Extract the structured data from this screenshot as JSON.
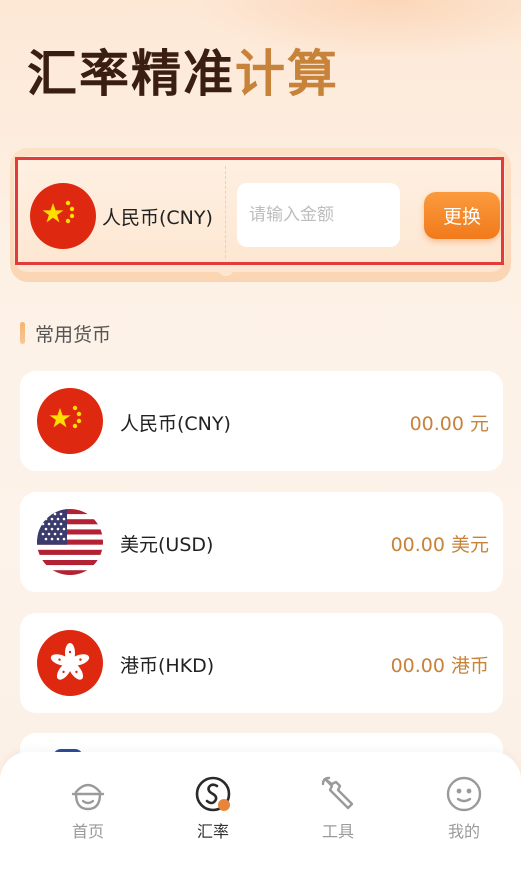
{
  "header": {
    "title_part1": "汇率精准",
    "title_part2": "计算"
  },
  "converter": {
    "currency_label": "人民币(CNY)",
    "flag": "cn-flag-icon",
    "amount_placeholder": "请输入金额",
    "amount_value": "",
    "swap_label": "更换"
  },
  "common_section": {
    "title": "常用货币",
    "items": [
      {
        "name": "人民币(CNY)",
        "amount": "00.00 元",
        "flag": "cn-flag-icon"
      },
      {
        "name": "美元(USD)",
        "amount": "00.00 美元",
        "flag": "us-flag-icon"
      },
      {
        "name": "港币(HKD)",
        "amount": "00.00 港币",
        "flag": "hk-flag-icon"
      }
    ]
  },
  "nav": {
    "items": [
      {
        "label": "首页",
        "icon": "home-icon",
        "active": false
      },
      {
        "label": "汇率",
        "icon": "exchange-rate-icon",
        "active": true
      },
      {
        "label": "工具",
        "icon": "wrench-icon",
        "active": false
      },
      {
        "label": "我的",
        "icon": "smiley-profile-icon",
        "active": false
      }
    ]
  },
  "colors": {
    "accent": "#c8833a",
    "button": "#f07a1c",
    "highlight_border": "#e23b3b",
    "title_dark": "#3a1e12"
  }
}
